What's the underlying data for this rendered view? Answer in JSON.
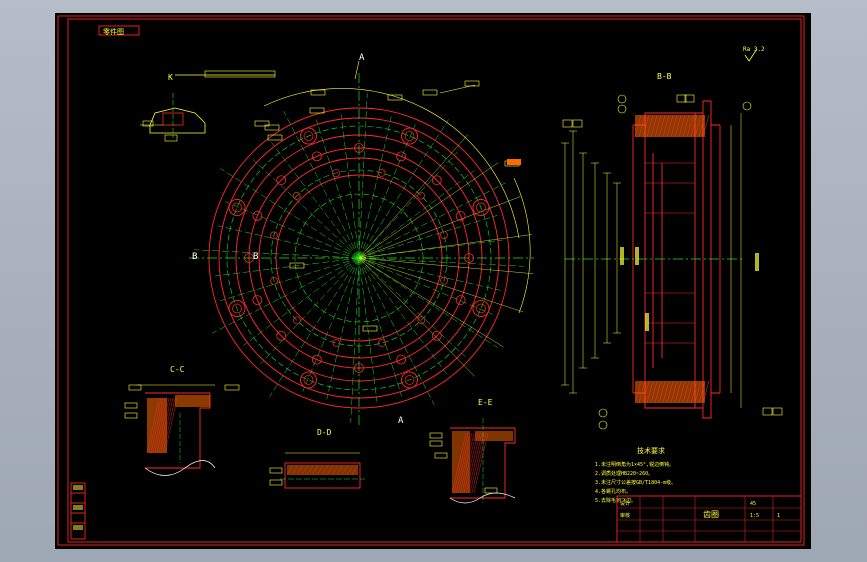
{
  "drawing": {
    "background": "#000000",
    "colors": {
      "frame": "#e02020",
      "outline": "#ff2a2a",
      "centerline": "#22dd22",
      "dimension": "#ffff33",
      "hatch": "#ff6a00",
      "text": "#ffff33",
      "alt": "#ffffff"
    },
    "title_tag": "零件图",
    "notes_heading": "技术要求",
    "notes": [
      "1.未注明倒角为1×45°,锐边倒钝。",
      "2.调质处理HB220~260。",
      "3.未注尺寸公差按GB/T1804-m级。",
      "4.各螺孔均布。",
      "5.去除毛刺飞边。"
    ],
    "roughness_mark": "Ra 3.2",
    "section_labels": {
      "main_left": "B",
      "main_right": "B",
      "main_top": "A",
      "main_bottom": "A",
      "side_view": "B-B",
      "detail_1": "C-C",
      "detail_2": "D-D",
      "detail_3": "E-E",
      "detail_k": "K"
    },
    "title_block": {
      "name": "齿圈",
      "material": "45",
      "scale": "1:5",
      "sheet": "1",
      "designer": "设计",
      "checker": "审核"
    }
  }
}
